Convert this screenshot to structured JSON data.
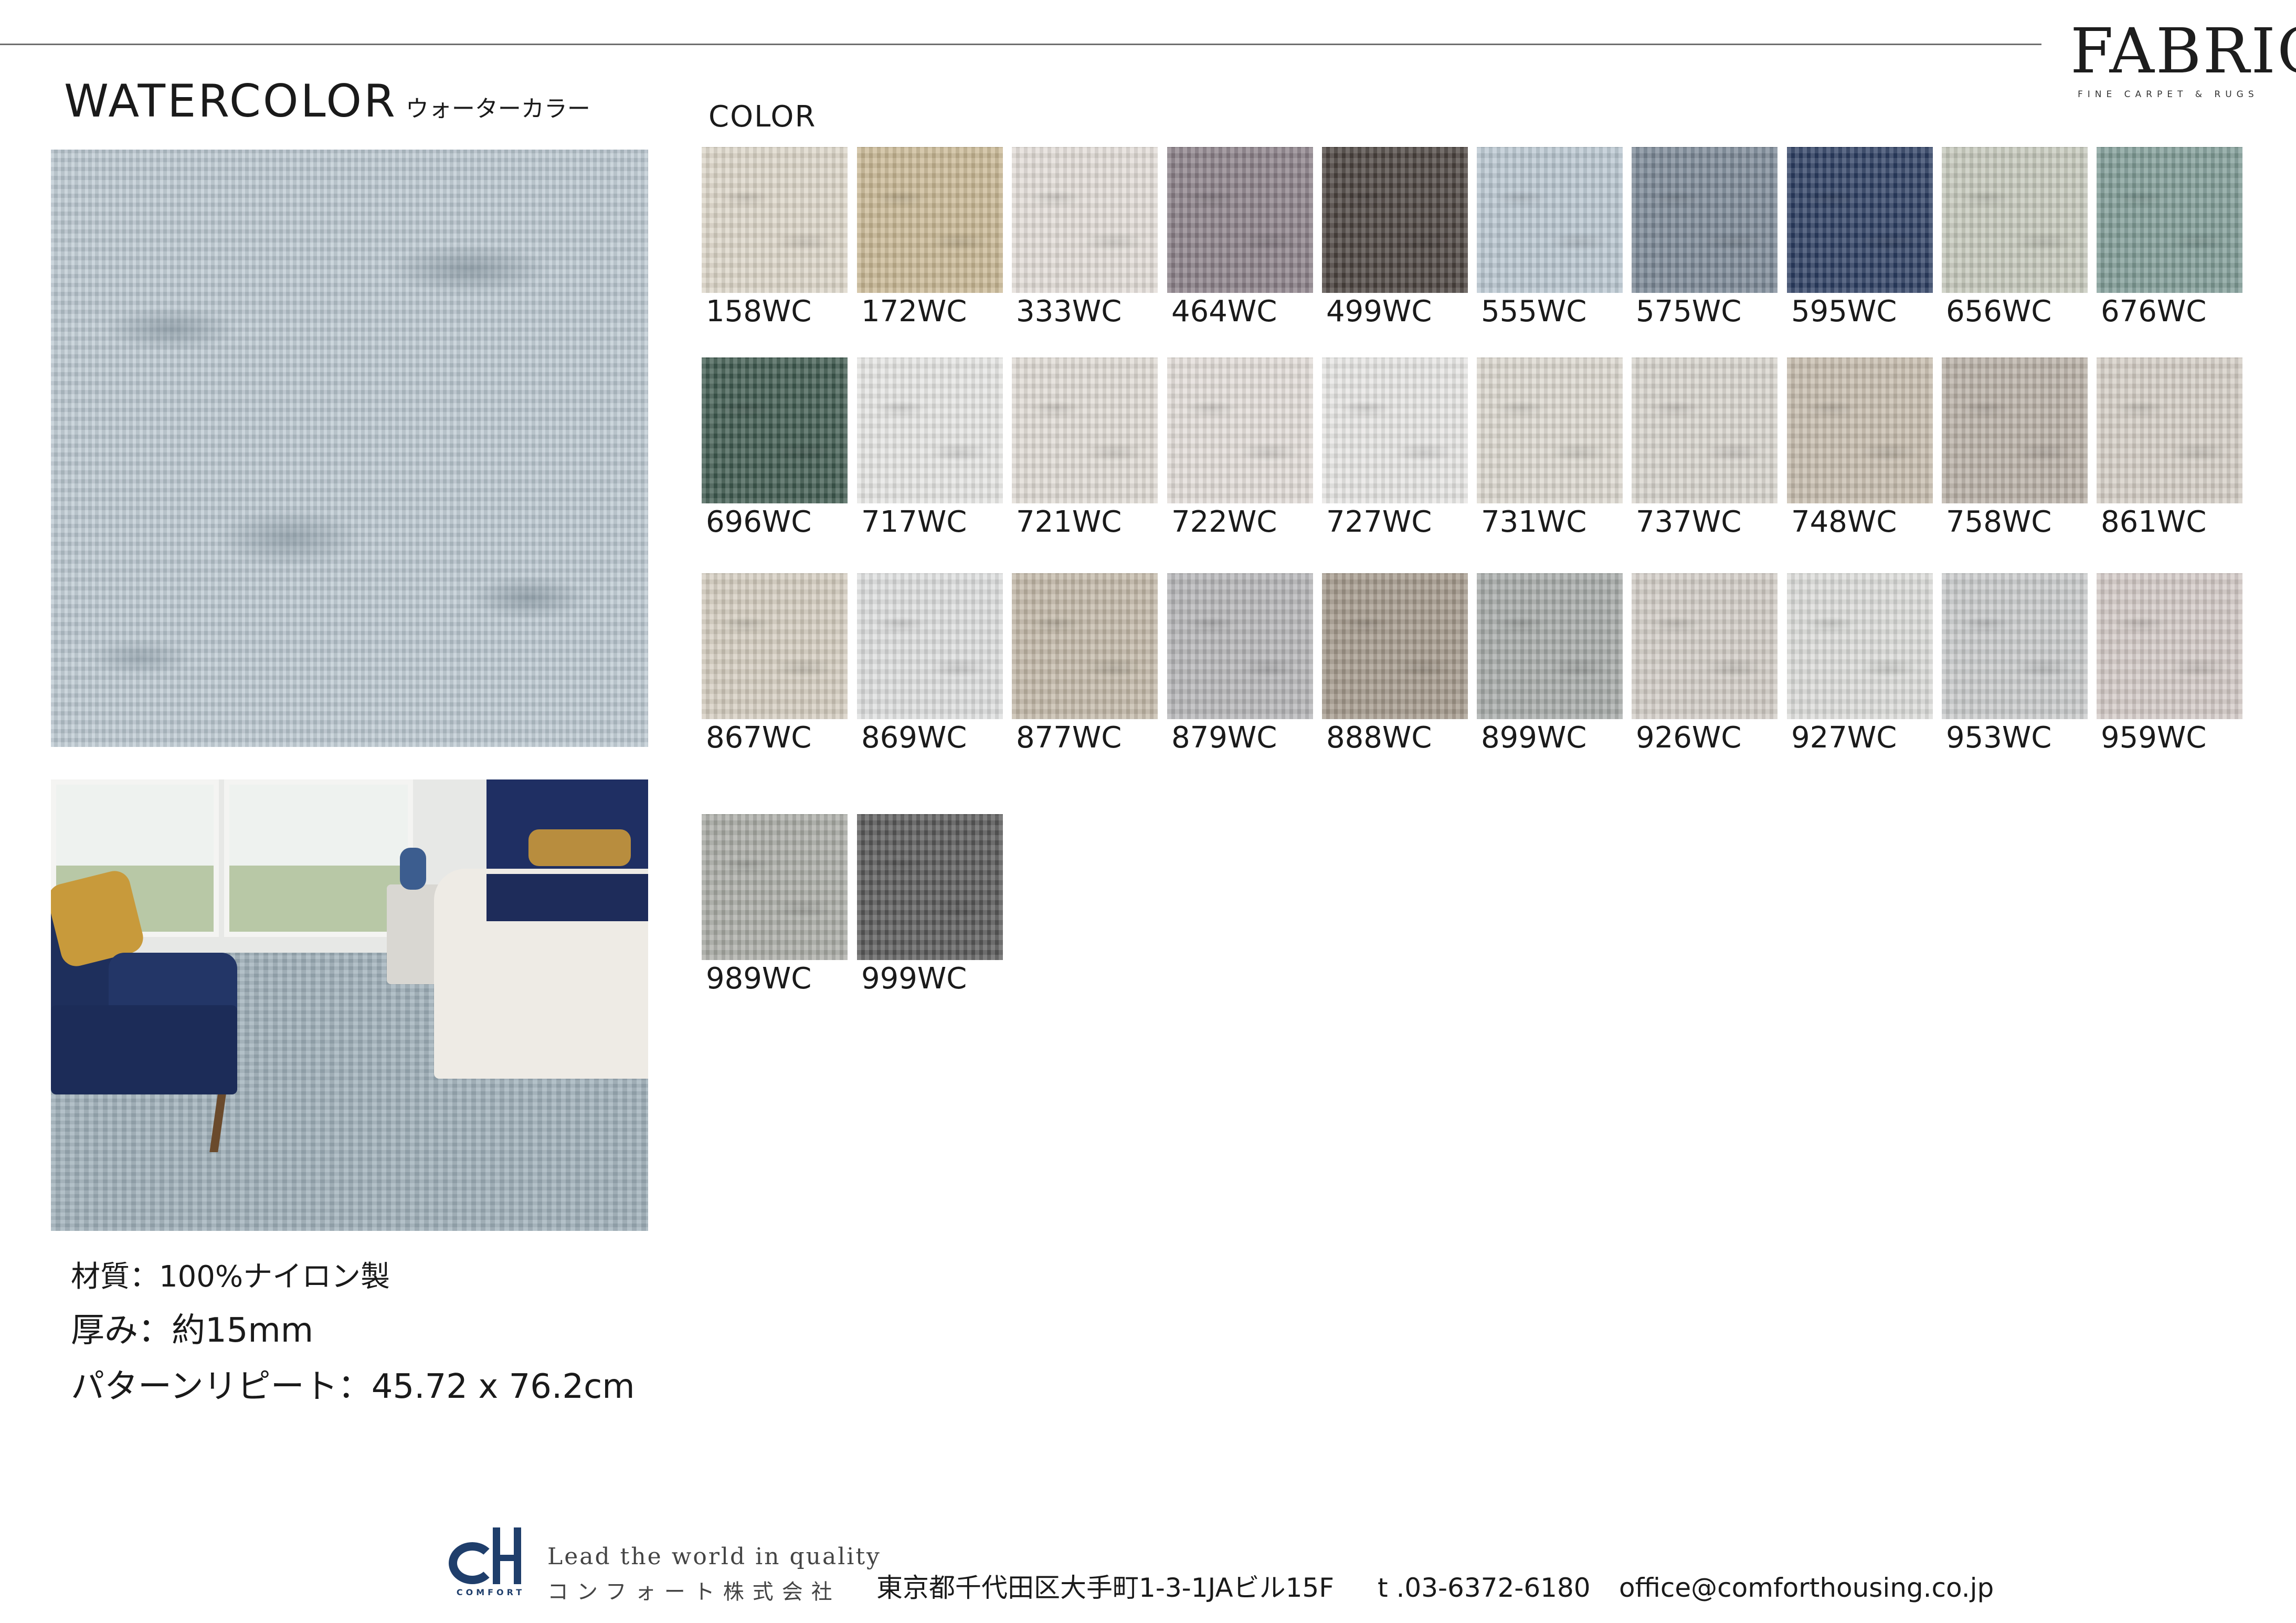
{
  "brand": {
    "logo_text": "FABRICA",
    "logo_subtext": "FINE CARPET & RUGS"
  },
  "product": {
    "name": "WATERCOLOR",
    "name_katakana": "ウォーターカラー"
  },
  "specs": {
    "material": "材質：100%ナイロン製",
    "thickness": "厚み：約15mm",
    "pattern_repeat": "パターンリピート：45.72 x 76.2cm"
  },
  "color_section": {
    "title": "COLOR",
    "swatches": [
      {
        "code": "158WC",
        "color": "#ddd6c8"
      },
      {
        "code": "172WC",
        "color": "#c9b894"
      },
      {
        "code": "333WC",
        "color": "#e2ddd7"
      },
      {
        "code": "464WC",
        "color": "#8b8088"
      },
      {
        "code": "499WC",
        "color": "#4b433f"
      },
      {
        "code": "555WC",
        "color": "#b9c6d0"
      },
      {
        "code": "575WC",
        "color": "#7b8896"
      },
      {
        "code": "595WC",
        "color": "#2c3e62"
      },
      {
        "code": "656WC",
        "color": "#c5c8bb"
      },
      {
        "code": "676WC",
        "color": "#7f9c96"
      },
      {
        "code": "696WC",
        "color": "#3f5a4f"
      },
      {
        "code": "717WC",
        "color": "#e5e5e3"
      },
      {
        "code": "721WC",
        "color": "#e0dbd4"
      },
      {
        "code": "722WC",
        "color": "#e2ddd8"
      },
      {
        "code": "727WC",
        "color": "#e6e5e3"
      },
      {
        "code": "731WC",
        "color": "#dcd8cf"
      },
      {
        "code": "737WC",
        "color": "#d8d4cd"
      },
      {
        "code": "748WC",
        "color": "#c6bcad"
      },
      {
        "code": "758WC",
        "color": "#b9b0a6"
      },
      {
        "code": "861WC",
        "color": "#d4cec5"
      },
      {
        "code": "867WC",
        "color": "#d4cdbf"
      },
      {
        "code": "869WC",
        "color": "#dedfdf"
      },
      {
        "code": "877WC",
        "color": "#c3b9a8"
      },
      {
        "code": "879WC",
        "color": "#b6b6b8"
      },
      {
        "code": "888WC",
        "color": "#a59a8c"
      },
      {
        "code": "899WC",
        "color": "#a7aba9"
      },
      {
        "code": "926WC",
        "color": "#d2cdc6"
      },
      {
        "code": "927WC",
        "color": "#dcddda"
      },
      {
        "code": "953WC",
        "color": "#c9cbcc"
      },
      {
        "code": "959WC",
        "color": "#d3cac6"
      },
      {
        "code": "989WC",
        "color": "#aaaca6"
      },
      {
        "code": "999WC",
        "color": "#5a5a5a"
      }
    ]
  },
  "footer": {
    "logo_word": "COMFORT",
    "tagline": "Lead the world in quality",
    "company_name": "コンフォート株式会社",
    "address": "東京都千代田区大手町1-3-1JAビル15F",
    "phone": "t .03-6372-6180",
    "email": "office@comforthousing.co.jp"
  }
}
